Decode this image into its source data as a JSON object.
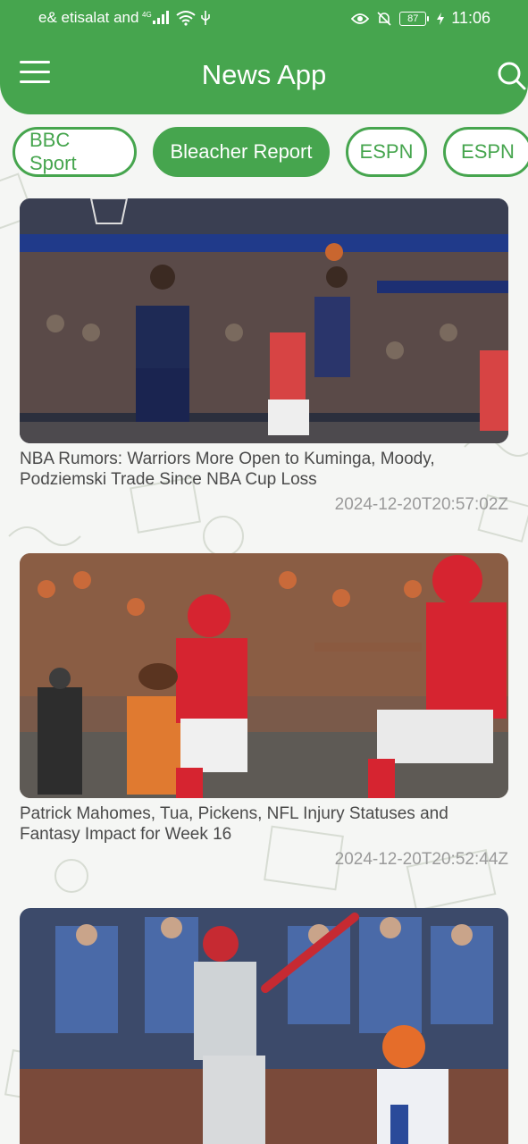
{
  "status_bar": {
    "carrier": "e& etisalat and",
    "network": "4G",
    "battery": "87",
    "time": "11:06"
  },
  "app_bar": {
    "title": "News App",
    "menu_icon": "hamburger-menu-icon",
    "search_icon": "search-icon"
  },
  "sources": [
    {
      "label": "BBC Sport",
      "active": false
    },
    {
      "label": "Bleacher Report",
      "active": true
    },
    {
      "label": "ESPN",
      "active": false
    },
    {
      "label": "ESPN",
      "active": false
    }
  ],
  "articles": [
    {
      "headline": "NBA Rumors: Warriors More Open to Kuminga, Moody, Podziemski Trade Since NBA Cup Loss",
      "date": "2024-12-20T20:57:02Z",
      "image": "basketball-game-photo"
    },
    {
      "headline": "Patrick Mahomes, Tua, Pickens, NFL Injury Statuses and Fantasy Impact for Week 16",
      "date": "2024-12-20T20:52:44Z",
      "image": "football-game-photo"
    },
    {
      "headline": "",
      "date": "",
      "image": "baseball-game-photo"
    }
  ],
  "colors": {
    "primary": "#46a54e",
    "background": "#f5f6f4",
    "date_text": "#9a9a9a"
  }
}
